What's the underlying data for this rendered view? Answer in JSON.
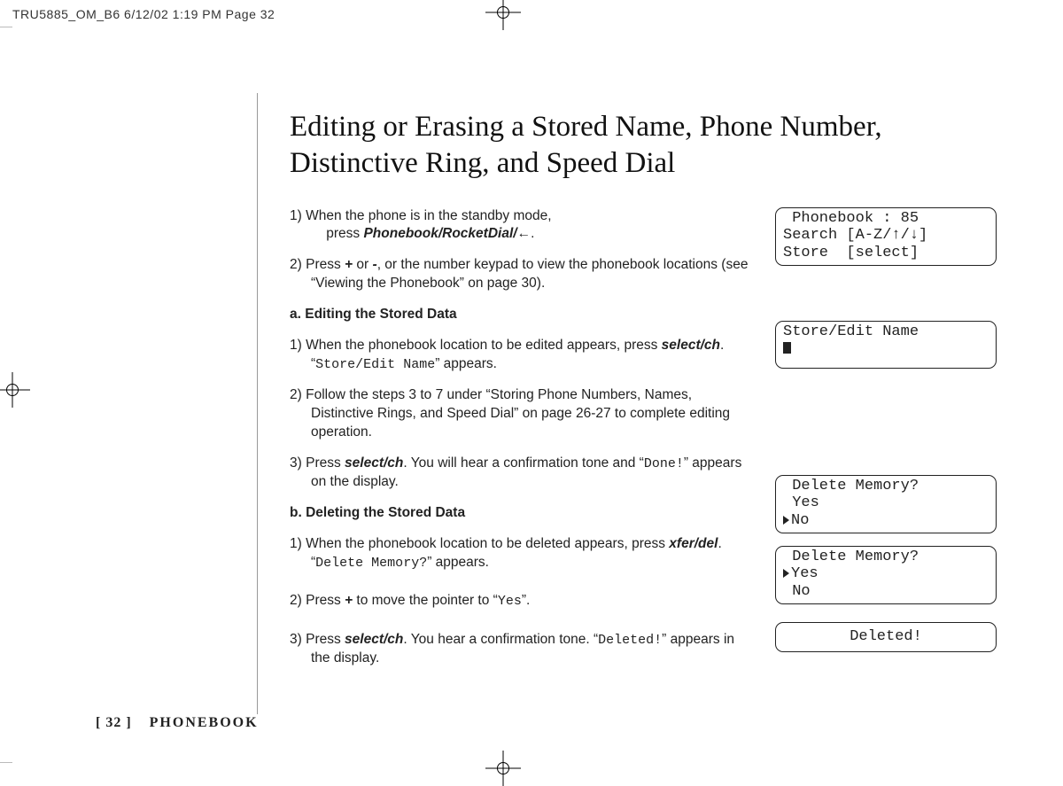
{
  "slug": "TRU5885_OM_B6  6/12/02  1:19 PM  Page 32",
  "title": "Editing or Erasing a Stored Name, Phone Number, Distinctive Ring, and Speed Dial",
  "steps": {
    "intro1_num": "1)",
    "intro1_a": "When the phone is in the standby mode,",
    "intro1_b": "press ",
    "intro1_key": "Phonebook/RocketDial/",
    "intro1_arrow": "←",
    "intro1_end": ".",
    "intro2_num": "2)",
    "intro2_a": "Press ",
    "intro2_plus": "+",
    "intro2_b": " or ",
    "intro2_minus": "-",
    "intro2_c": ", or the number keypad to view the phonebook locations (see “Viewing the Phonebook” on page 30).",
    "a_head": "a. Editing the Stored Data",
    "a1_num": "1)",
    "a1_a": "When the phonebook location to be edited appears, press ",
    "a1_key": "select/ch",
    "a1_b": ". “",
    "a1_lcd": "Store/Edit Name",
    "a1_c": "” appears.",
    "a2_num": "2)",
    "a2": "Follow the steps 3 to 7 under “Storing Phone Numbers, Names, Distinctive Rings, and Speed Dial” on page 26-27 to complete editing operation.",
    "a3_num": "3)",
    "a3_a": "Press ",
    "a3_key": "select/ch",
    "a3_b": ". You will hear a confirmation tone and “",
    "a3_lcd": "Done!",
    "a3_c": "” appears on the display.",
    "b_head": "b. Deleting the Stored Data",
    "b1_num": "1)",
    "b1_a": "When the phonebook location to be deleted appears, press ",
    "b1_key": "xfer/del",
    "b1_b": ". “",
    "b1_lcd": "Delete Memory?",
    "b1_c": "” appears.",
    "b2_num": "2)",
    "b2_a": "Press ",
    "b2_plus": "+",
    "b2_b": " to move the pointer to “",
    "b2_lcd": "Yes",
    "b2_c": "”.",
    "b3_num": "3)",
    "b3_a": "Press ",
    "b3_key": "select/ch",
    "b3_b": ". You hear a confirmation tone. “",
    "b3_lcd": "Deleted!",
    "b3_c": "” appears in the display."
  },
  "screens": {
    "s1": {
      "l1": " Phonebook : 85",
      "l2": "Search [A-Z/↑/↓]",
      "l3": "Store  [select]"
    },
    "s2": {
      "l1": "Store/Edit Name"
    },
    "s3": {
      "l1": " Delete Memory?",
      "l2": " Yes",
      "l3": "No"
    },
    "s4": {
      "l1": " Delete Memory?",
      "l2": "Yes",
      "l3": " No"
    },
    "s5": {
      "l1": "Deleted!"
    }
  },
  "footer": {
    "page": "[ 32 ]",
    "section": "PHONEBOOK"
  }
}
